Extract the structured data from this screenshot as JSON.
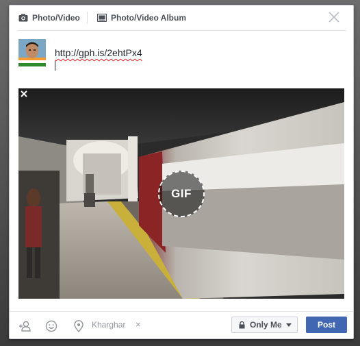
{
  "tabs": [
    {
      "label": "Photo/Video",
      "icon": "camera-icon"
    },
    {
      "label": "Photo/Video Album",
      "icon": "album-icon"
    }
  ],
  "composer": {
    "text": "http://gph.is/2ehtPx4",
    "avatar": "user-avatar"
  },
  "preview": {
    "badge_label": "GIF",
    "remove_icon": "close-icon"
  },
  "footer": {
    "location": "Kharghar",
    "location_remove": "×",
    "audience_label": "Only Me",
    "post_label": "Post",
    "icons": [
      "tag-friends-icon",
      "feeling-icon",
      "location-pin-icon",
      "lock-icon",
      "chevron-down-icon"
    ]
  },
  "colors": {
    "accent": "#4267b2",
    "text_primary": "#1d2129",
    "text_muted": "#90949c",
    "tab_text": "#4b4f56"
  }
}
